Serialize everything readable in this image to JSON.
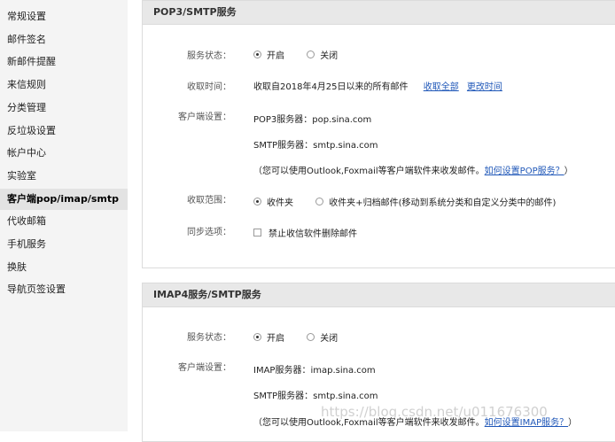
{
  "sidebar": {
    "items": [
      {
        "label": "常规设置",
        "active": false
      },
      {
        "label": "邮件签名",
        "active": false
      },
      {
        "label": "新邮件提醒",
        "active": false
      },
      {
        "label": "来信规则",
        "active": false
      },
      {
        "label": "分类管理",
        "active": false
      },
      {
        "label": "反垃圾设置",
        "active": false
      },
      {
        "label": "帐户中心",
        "active": false
      },
      {
        "label": "实验室",
        "active": false
      },
      {
        "label": "客户端pop/imap/smtp",
        "active": true
      },
      {
        "label": "代收邮箱",
        "active": false
      },
      {
        "label": "手机服务",
        "active": false
      },
      {
        "label": "换肤",
        "active": false
      },
      {
        "label": "导航页签设置",
        "active": false
      }
    ]
  },
  "pop3": {
    "title": "POP3/SMTP服务",
    "status_label": "服务状态：",
    "status_on": "开启",
    "status_off": "关闭",
    "status_selected": "on",
    "time_label": "收取时间：",
    "time_value": "收取自2018年4月25日以来的所有邮件",
    "time_link_all": "收取全部",
    "time_link_change": "更改时间",
    "client_label": "客户端设置：",
    "pop_server": "POP3服务器：pop.sina.com",
    "smtp_server": "SMTP服务器：smtp.sina.com",
    "hint_prefix": "（您可以使用Outlook,Foxmail等客户端软件来收发邮件。",
    "hint_link": "如何设置POP服务？",
    "hint_suffix": "）",
    "range_label": "收取范围：",
    "range_inbox": "收件夹",
    "range_all": "收件夹+归档邮件(移动到系统分类和自定义分类中的邮件)",
    "range_selected": "inbox",
    "sync_label": "同步选项：",
    "sync_option": "禁止收信软件删除邮件",
    "sync_checked": false
  },
  "imap": {
    "title": "IMAP4服务/SMTP服务",
    "status_label": "服务状态：",
    "status_on": "开启",
    "status_off": "关闭",
    "status_selected": "on",
    "client_label": "客户端设置：",
    "imap_server": "IMAP服务器：imap.sina.com",
    "smtp_server": "SMTP服务器：smtp.sina.com",
    "hint_prefix": "（您可以使用Outlook,Foxmail等客户端软件来收发邮件。",
    "hint_link": "如何设置IMAP服务？",
    "hint_suffix": "）"
  },
  "watermark": "https://blog.csdn.net/u011676300"
}
